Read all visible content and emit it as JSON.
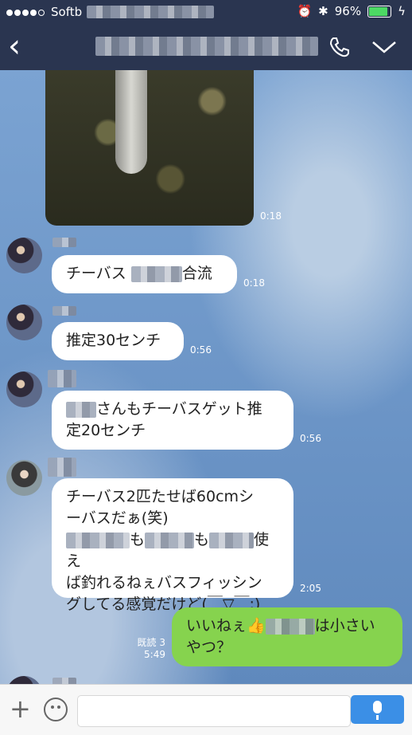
{
  "status": {
    "carrier": "Softb",
    "battery": "96%",
    "battery_level": 0.96
  },
  "nav": {
    "back": "‹",
    "call_icon": "phone-icon",
    "menu_icon": "chevron-down-icon"
  },
  "messages": {
    "photo_time": "0:18",
    "m1": {
      "text_a": "チーバス ",
      "text_b": "合流",
      "time": "0:18"
    },
    "m2": {
      "text": "推定30センチ",
      "time": "0:56"
    },
    "m3": {
      "text_a": "さんもチーバスゲット推",
      "text_b": "定20センチ",
      "time": "0:56"
    },
    "m4": {
      "line1": "チーバス2匹たせば60cmシ",
      "line2": "ーバスだぁ(笑)",
      "line3_a": "も",
      "line3_b": "も",
      "line3_c": "使え",
      "line4": "ば釣れるねぇバスフィッシン",
      "line5": "グしてる感覚だけど(￣▽￣;)",
      "time": "2:05"
    },
    "m5": {
      "text_a": "いいねぇ👍",
      "text_b": "は小さい",
      "line2": "やつ？",
      "read": "既読 3",
      "time": "5:49"
    }
  },
  "input": {
    "placeholder": ""
  }
}
